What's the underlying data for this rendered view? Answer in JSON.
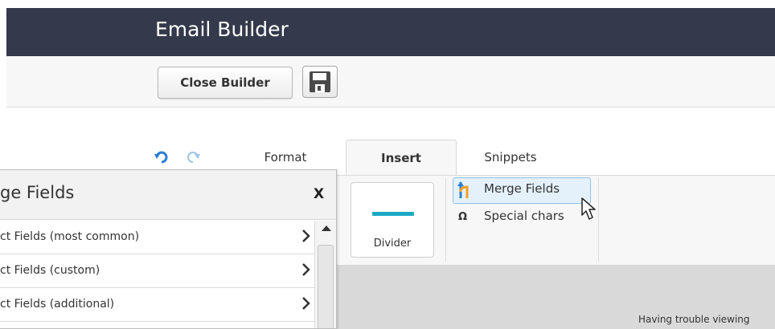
{
  "app": {
    "title": "Email Builder"
  },
  "toolbar": {
    "close_label": "Close Builder",
    "save_icon": "floppy-disk-icon"
  },
  "tabs": [
    {
      "label": "Format",
      "active": false
    },
    {
      "label": "Insert",
      "active": true
    },
    {
      "label": "Snippets",
      "active": false
    }
  ],
  "ribbon": {
    "divider_label": "Divider",
    "divider_color": "#1ba8c4",
    "merge_fields_label": "Merge Fields",
    "special_chars_symbol": "Ω",
    "special_chars_label": "Special chars"
  },
  "panel": {
    "title": "ge Fields",
    "close_label": "X",
    "items": [
      {
        "label": "ct Fields (most common)"
      },
      {
        "label": "ct Fields (custom)"
      },
      {
        "label": "ct Fields (additional)"
      }
    ]
  },
  "canvas": {
    "preview_text": "Having trouble viewing"
  },
  "colors": {
    "header_bg": "#343a4b",
    "accent": "#1ba8c4",
    "highlight": "#e4f1fb"
  }
}
